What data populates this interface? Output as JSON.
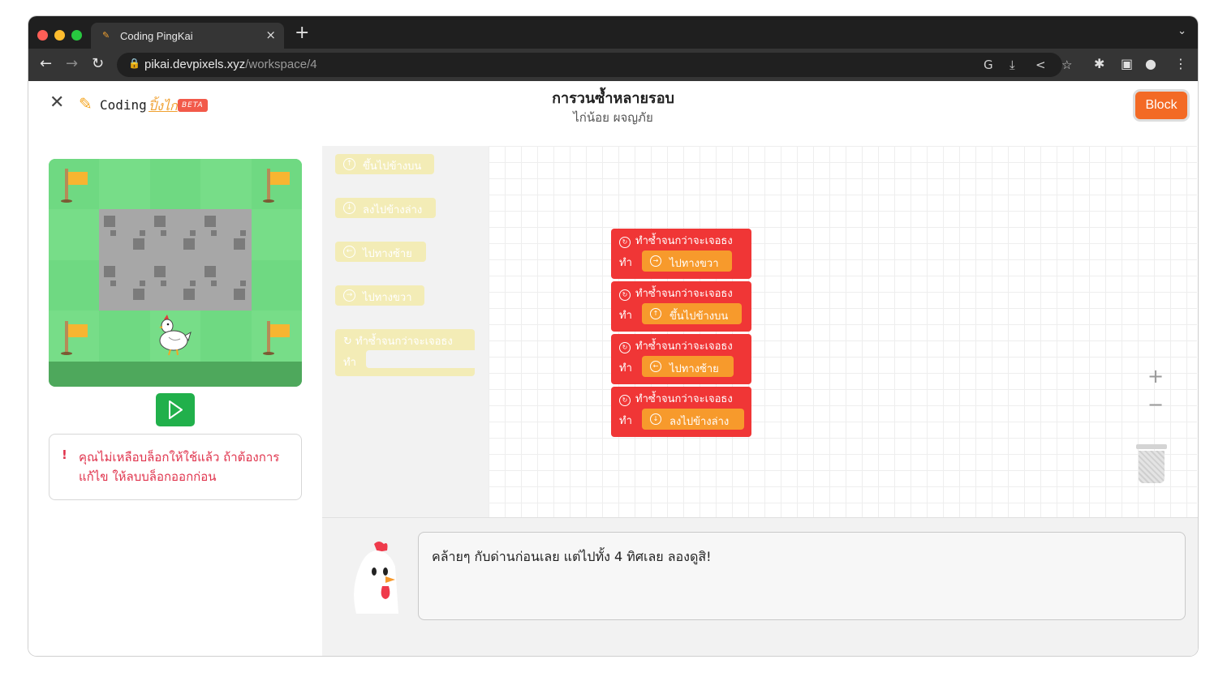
{
  "browser": {
    "tab_title": "Coding PingKai",
    "url_domain": "pikai.devpixels.xyz",
    "url_path": "/workspace/4"
  },
  "header": {
    "logo_text": "Coding",
    "logo_thai": "ปิ้งไก่",
    "beta_label": "BETA",
    "title": "การวนซ้ำหลายรอบ",
    "subtitle": "ไก่น้อย ผจญภัย",
    "mode_button": "Block"
  },
  "notice": {
    "message": "คุณไม่เหลือบล็อกให้ใช้แล้ว ถ้าต้องการแก้ไข ให้ลบบล็อกออกก่อน"
  },
  "toolbox": {
    "blocks": [
      "ขึ้นไปข้างบน",
      "ลงไปข้างล่าง",
      "ไปทางซ้าย",
      "ไปทางขวา"
    ],
    "loop_label": "ทำซ้ำจนกว่าจะเจอธง",
    "do_label": "ทำ"
  },
  "workspace": {
    "loops": [
      {
        "label": "ทำซ้ำจนกว่าจะเจอธง",
        "do": "ทำ",
        "inner": "ไปทางขวา"
      },
      {
        "label": "ทำซ้ำจนกว่าจะเจอธง",
        "do": "ทำ",
        "inner": "ขึ้นไปข้างบน"
      },
      {
        "label": "ทำซ้ำจนกว่าจะเจอธง",
        "do": "ทำ",
        "inner": "ไปทางซ้าย"
      },
      {
        "label": "ทำซ้ำจนกว่าจะเจอธง",
        "do": "ทำ",
        "inner": "ลงไปข้างล่าง"
      }
    ]
  },
  "hint": {
    "text": "คล้ายๆ กับด่านก่อนเลย แต่ไปทั้ง 4 ทิศเลย ลองดูสิ!"
  },
  "colors": {
    "loop_block": "#f03636",
    "move_block": "#f79a2c",
    "run_button": "#21b04b",
    "mode_button": "#f36a25",
    "error_text": "#e0344d"
  }
}
